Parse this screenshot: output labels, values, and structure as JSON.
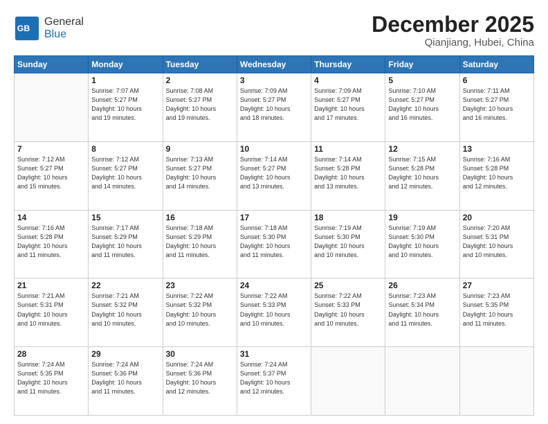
{
  "logo": {
    "general": "General",
    "blue": "Blue"
  },
  "title": {
    "month": "December 2025",
    "location": "Qianjiang, Hubei, China"
  },
  "headers": [
    "Sunday",
    "Monday",
    "Tuesday",
    "Wednesday",
    "Thursday",
    "Friday",
    "Saturday"
  ],
  "weeks": [
    [
      {
        "day": "",
        "info": ""
      },
      {
        "day": "1",
        "info": "Sunrise: 7:07 AM\nSunset: 5:27 PM\nDaylight: 10 hours\nand 19 minutes."
      },
      {
        "day": "2",
        "info": "Sunrise: 7:08 AM\nSunset: 5:27 PM\nDaylight: 10 hours\nand 19 minutes."
      },
      {
        "day": "3",
        "info": "Sunrise: 7:09 AM\nSunset: 5:27 PM\nDaylight: 10 hours\nand 18 minutes."
      },
      {
        "day": "4",
        "info": "Sunrise: 7:09 AM\nSunset: 5:27 PM\nDaylight: 10 hours\nand 17 minutes."
      },
      {
        "day": "5",
        "info": "Sunrise: 7:10 AM\nSunset: 5:27 PM\nDaylight: 10 hours\nand 16 minutes."
      },
      {
        "day": "6",
        "info": "Sunrise: 7:11 AM\nSunset: 5:27 PM\nDaylight: 10 hours\nand 16 minutes."
      }
    ],
    [
      {
        "day": "7",
        "info": "Sunrise: 7:12 AM\nSunset: 5:27 PM\nDaylight: 10 hours\nand 15 minutes."
      },
      {
        "day": "8",
        "info": "Sunrise: 7:12 AM\nSunset: 5:27 PM\nDaylight: 10 hours\nand 14 minutes."
      },
      {
        "day": "9",
        "info": "Sunrise: 7:13 AM\nSunset: 5:27 PM\nDaylight: 10 hours\nand 14 minutes."
      },
      {
        "day": "10",
        "info": "Sunrise: 7:14 AM\nSunset: 5:27 PM\nDaylight: 10 hours\nand 13 minutes."
      },
      {
        "day": "11",
        "info": "Sunrise: 7:14 AM\nSunset: 5:28 PM\nDaylight: 10 hours\nand 13 minutes."
      },
      {
        "day": "12",
        "info": "Sunrise: 7:15 AM\nSunset: 5:28 PM\nDaylight: 10 hours\nand 12 minutes."
      },
      {
        "day": "13",
        "info": "Sunrise: 7:16 AM\nSunset: 5:28 PM\nDaylight: 10 hours\nand 12 minutes."
      }
    ],
    [
      {
        "day": "14",
        "info": "Sunrise: 7:16 AM\nSunset: 5:28 PM\nDaylight: 10 hours\nand 11 minutes."
      },
      {
        "day": "15",
        "info": "Sunrise: 7:17 AM\nSunset: 5:29 PM\nDaylight: 10 hours\nand 11 minutes."
      },
      {
        "day": "16",
        "info": "Sunrise: 7:18 AM\nSunset: 5:29 PM\nDaylight: 10 hours\nand 11 minutes."
      },
      {
        "day": "17",
        "info": "Sunrise: 7:18 AM\nSunset: 5:30 PM\nDaylight: 10 hours\nand 11 minutes."
      },
      {
        "day": "18",
        "info": "Sunrise: 7:19 AM\nSunset: 5:30 PM\nDaylight: 10 hours\nand 10 minutes."
      },
      {
        "day": "19",
        "info": "Sunrise: 7:19 AM\nSunset: 5:30 PM\nDaylight: 10 hours\nand 10 minutes."
      },
      {
        "day": "20",
        "info": "Sunrise: 7:20 AM\nSunset: 5:31 PM\nDaylight: 10 hours\nand 10 minutes."
      }
    ],
    [
      {
        "day": "21",
        "info": "Sunrise: 7:21 AM\nSunset: 5:31 PM\nDaylight: 10 hours\nand 10 minutes."
      },
      {
        "day": "22",
        "info": "Sunrise: 7:21 AM\nSunset: 5:32 PM\nDaylight: 10 hours\nand 10 minutes."
      },
      {
        "day": "23",
        "info": "Sunrise: 7:22 AM\nSunset: 5:32 PM\nDaylight: 10 hours\nand 10 minutes."
      },
      {
        "day": "24",
        "info": "Sunrise: 7:22 AM\nSunset: 5:33 PM\nDaylight: 10 hours\nand 10 minutes."
      },
      {
        "day": "25",
        "info": "Sunrise: 7:22 AM\nSunset: 5:33 PM\nDaylight: 10 hours\nand 10 minutes."
      },
      {
        "day": "26",
        "info": "Sunrise: 7:23 AM\nSunset: 5:34 PM\nDaylight: 10 hours\nand 11 minutes."
      },
      {
        "day": "27",
        "info": "Sunrise: 7:23 AM\nSunset: 5:35 PM\nDaylight: 10 hours\nand 11 minutes."
      }
    ],
    [
      {
        "day": "28",
        "info": "Sunrise: 7:24 AM\nSunset: 5:35 PM\nDaylight: 10 hours\nand 11 minutes."
      },
      {
        "day": "29",
        "info": "Sunrise: 7:24 AM\nSunset: 5:36 PM\nDaylight: 10 hours\nand 11 minutes."
      },
      {
        "day": "30",
        "info": "Sunrise: 7:24 AM\nSunset: 5:36 PM\nDaylight: 10 hours\nand 12 minutes."
      },
      {
        "day": "31",
        "info": "Sunrise: 7:24 AM\nSunset: 5:37 PM\nDaylight: 10 hours\nand 12 minutes."
      },
      {
        "day": "",
        "info": ""
      },
      {
        "day": "",
        "info": ""
      },
      {
        "day": "",
        "info": ""
      }
    ]
  ]
}
